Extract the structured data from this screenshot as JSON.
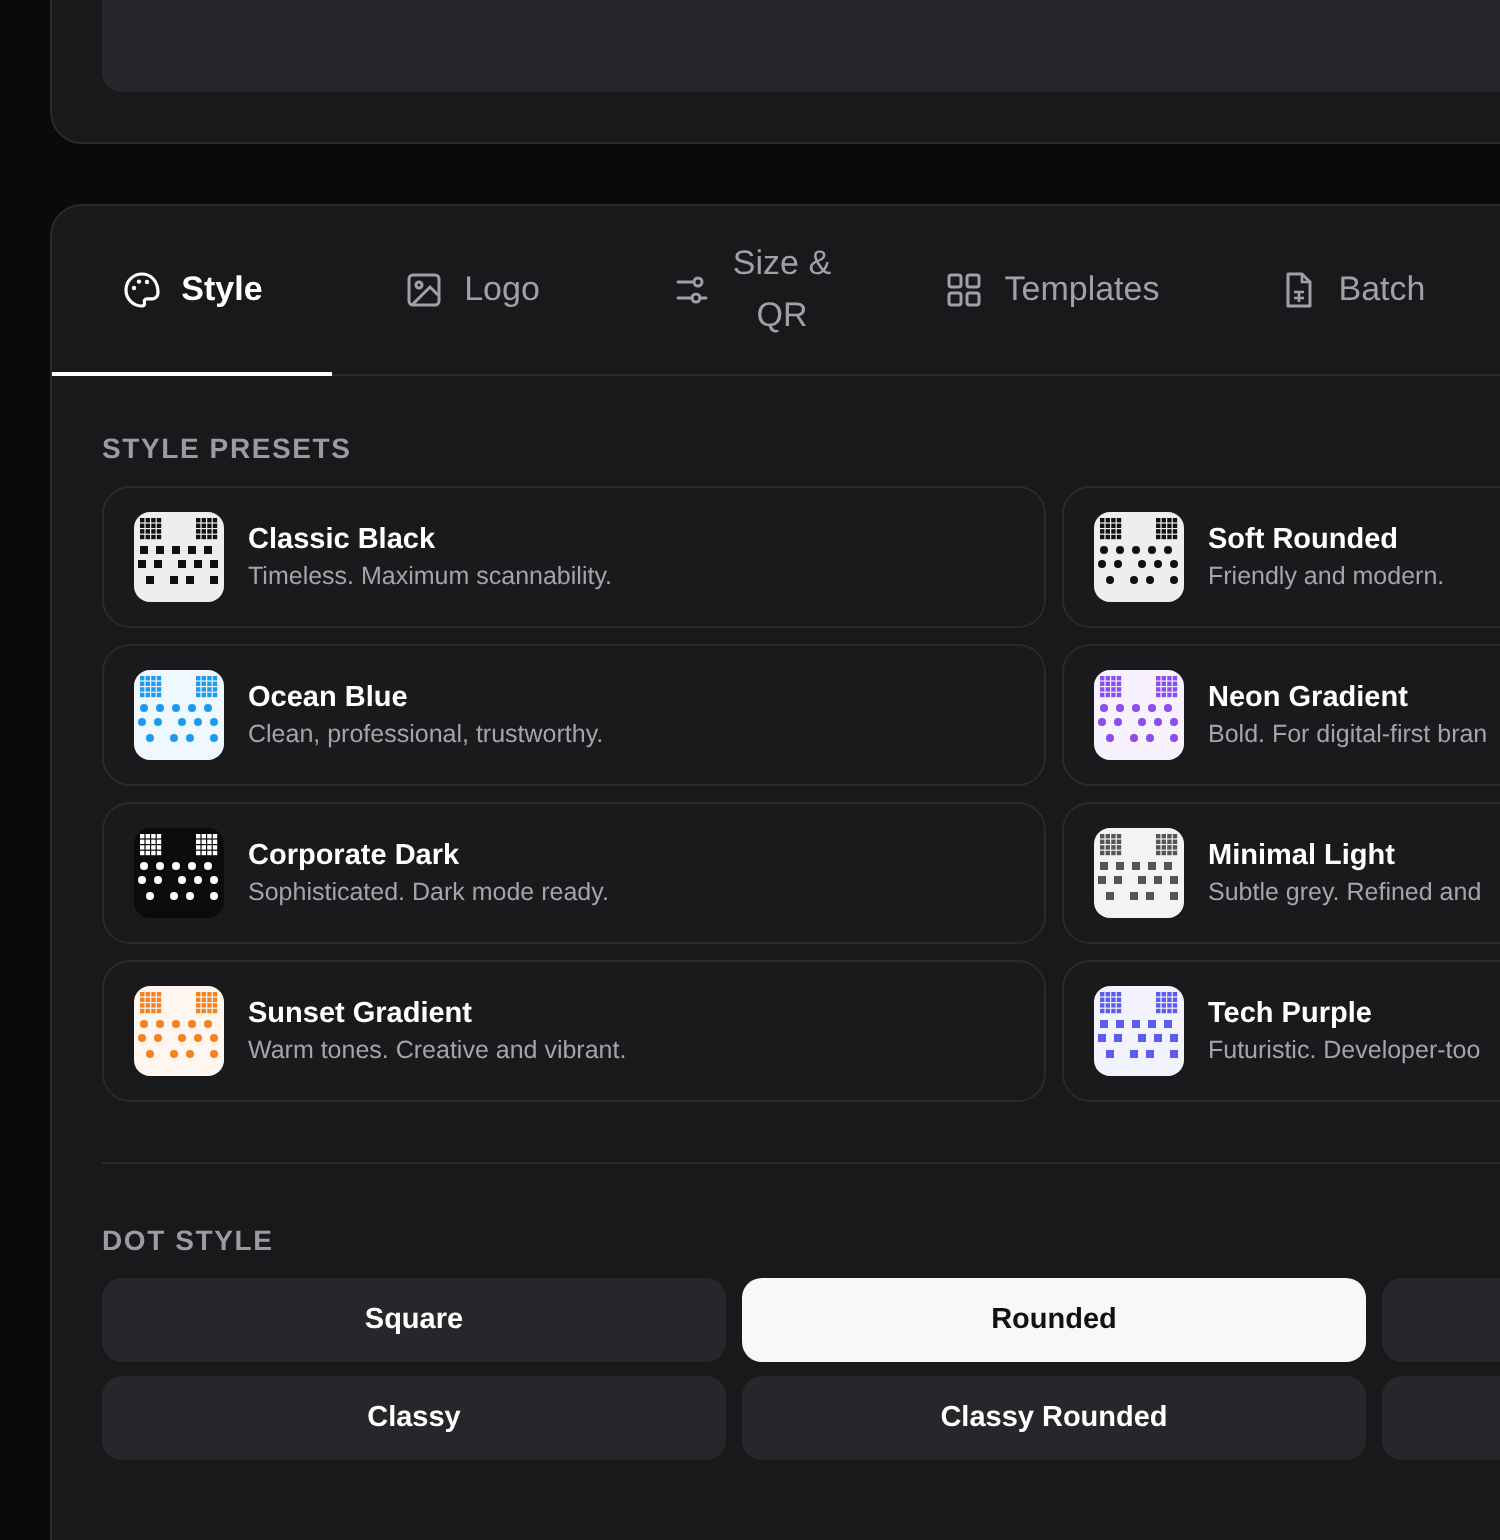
{
  "tabs": [
    {
      "label": "Style",
      "selected": true
    },
    {
      "label": "Logo",
      "selected": false
    },
    {
      "label": "Size &\nQR",
      "selected": false
    },
    {
      "label": "Templates",
      "selected": false
    },
    {
      "label": "Batch",
      "selected": false
    }
  ],
  "style_presets": {
    "heading": "STYLE PRESETS",
    "items": [
      {
        "name": "Classic Black",
        "description": "Timeless. Maximum scannability.",
        "color": "#111111",
        "kind": "square"
      },
      {
        "name": "Soft Rounded",
        "description": "Friendly and modern.",
        "color": "#111111",
        "kind": "round"
      },
      {
        "name": "Ocean Blue",
        "description": "Clean, professional, trustworthy.",
        "color": "#1e9bf0",
        "kind": "round"
      },
      {
        "name": "Neon Gradient",
        "description": "Bold. For digital-first bran",
        "color": "#8b4cf0",
        "kind": "round"
      },
      {
        "name": "Corporate Dark",
        "description": "Sophisticated. Dark mode ready.",
        "color": "#ffffff",
        "kind": "dark"
      },
      {
        "name": "Minimal Light",
        "description": "Subtle grey. Refined and",
        "color": "#555555",
        "kind": "square"
      },
      {
        "name": "Sunset Gradient",
        "description": "Warm tones. Creative and vibrant.",
        "color": "#f58220",
        "kind": "round"
      },
      {
        "name": "Tech Purple",
        "description": "Futuristic. Developer-too",
        "color": "#5b5bf0",
        "kind": "square"
      }
    ]
  },
  "dot_style": {
    "heading": "DOT STYLE",
    "options": [
      {
        "label": "Square",
        "selected": false
      },
      {
        "label": "Rounded",
        "selected": true
      },
      {
        "label": "Classy",
        "selected": false
      },
      {
        "label": "Classy Rounded",
        "selected": false
      }
    ]
  }
}
